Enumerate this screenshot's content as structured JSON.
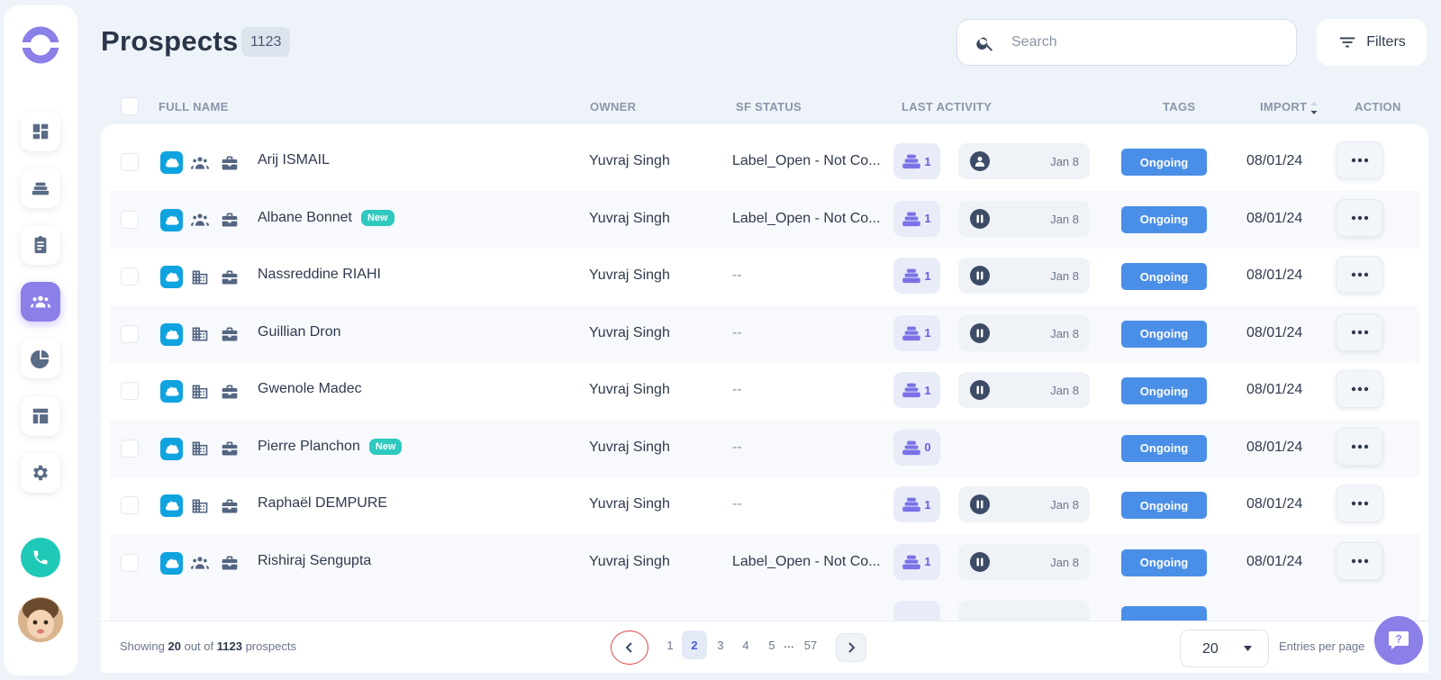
{
  "header": {
    "title": "Prospects",
    "count": "1123",
    "search_placeholder": "Search",
    "filters_label": "Filters"
  },
  "sidebar": {
    "items": [
      {
        "name": "dashboard",
        "icon": "dashboard-icon",
        "active": false
      },
      {
        "name": "sequences",
        "icon": "stack-icon",
        "active": false
      },
      {
        "name": "tasks",
        "icon": "clipboard-icon",
        "active": false
      },
      {
        "name": "prospects",
        "icon": "people-icon",
        "active": true
      },
      {
        "name": "reports",
        "icon": "pie-chart-icon",
        "active": false
      },
      {
        "name": "templates",
        "icon": "layout-icon",
        "active": false
      },
      {
        "name": "settings",
        "icon": "gear-icon",
        "active": false
      }
    ]
  },
  "columns": {
    "full_name": "FULL NAME",
    "owner": "OWNER",
    "sf_status": "SF STATUS",
    "last_activity": "LAST ACTIVITY",
    "tags": "TAGS",
    "import": "IMPORT",
    "action": "ACTION"
  },
  "rows": [
    {
      "name": "Arij ISMAIL",
      "new": false,
      "type": "people",
      "owner": "Yuvraj Singh",
      "sf_status": "Label_Open - Not Co...",
      "seq": "1",
      "activity_icon": "person-icon",
      "activity_date": "Jan 8",
      "tag": "Ongoing",
      "import": "08/01/24"
    },
    {
      "name": "Albane Bonnet",
      "new": true,
      "type": "people",
      "owner": "Yuvraj Singh",
      "sf_status": "Label_Open - Not Co...",
      "seq": "1",
      "activity_icon": "pause-icon",
      "activity_date": "Jan 8",
      "tag": "Ongoing",
      "import": "08/01/24"
    },
    {
      "name": "Nassreddine RIAHI",
      "new": false,
      "type": "building",
      "owner": "Yuvraj Singh",
      "sf_status": "--",
      "seq": "1",
      "activity_icon": "pause-icon",
      "activity_date": "Jan 8",
      "tag": "Ongoing",
      "import": "08/01/24"
    },
    {
      "name": "Guillian Dron",
      "new": false,
      "type": "building",
      "owner": "Yuvraj Singh",
      "sf_status": "--",
      "seq": "1",
      "activity_icon": "pause-icon",
      "activity_date": "Jan 8",
      "tag": "Ongoing",
      "import": "08/01/24"
    },
    {
      "name": "Gwenole Madec",
      "new": false,
      "type": "building",
      "owner": "Yuvraj Singh",
      "sf_status": "--",
      "seq": "1",
      "activity_icon": "pause-icon",
      "activity_date": "Jan 8",
      "tag": "Ongoing",
      "import": "08/01/24"
    },
    {
      "name": "Pierre Planchon",
      "new": true,
      "type": "building",
      "owner": "Yuvraj Singh",
      "sf_status": "--",
      "seq": "0",
      "activity_icon": "",
      "activity_date": "",
      "tag": "Ongoing",
      "import": "08/01/24"
    },
    {
      "name": "Raphaël DEMPURE",
      "new": false,
      "type": "building",
      "owner": "Yuvraj Singh",
      "sf_status": "--",
      "seq": "1",
      "activity_icon": "pause-icon",
      "activity_date": "Jan 8",
      "tag": "Ongoing",
      "import": "08/01/24"
    },
    {
      "name": "Rishiraj Sengupta",
      "new": false,
      "type": "people",
      "owner": "Yuvraj Singh",
      "sf_status": "Label_Open - Not Co...",
      "seq": "1",
      "activity_icon": "pause-icon",
      "activity_date": "Jan 8",
      "tag": "Ongoing",
      "import": "08/01/24"
    }
  ],
  "new_badge": "New",
  "footer": {
    "showing_prefix": "Showing",
    "showing_count": "20",
    "showing_mid": "out of",
    "showing_total": "1123",
    "showing_suffix": "prospects",
    "pages": [
      "1",
      "2",
      "3",
      "4",
      "5"
    ],
    "current_page": "2",
    "dots": "...",
    "last_page": "57",
    "per_page": "20",
    "per_page_label": "Entries per page"
  },
  "colors": {
    "accent": "#8b7fe8",
    "tag": "#4a8fe7",
    "salesforce": "#0fa3e0",
    "new_badge": "#2ec9bf",
    "phone": "#1fc9b7"
  }
}
